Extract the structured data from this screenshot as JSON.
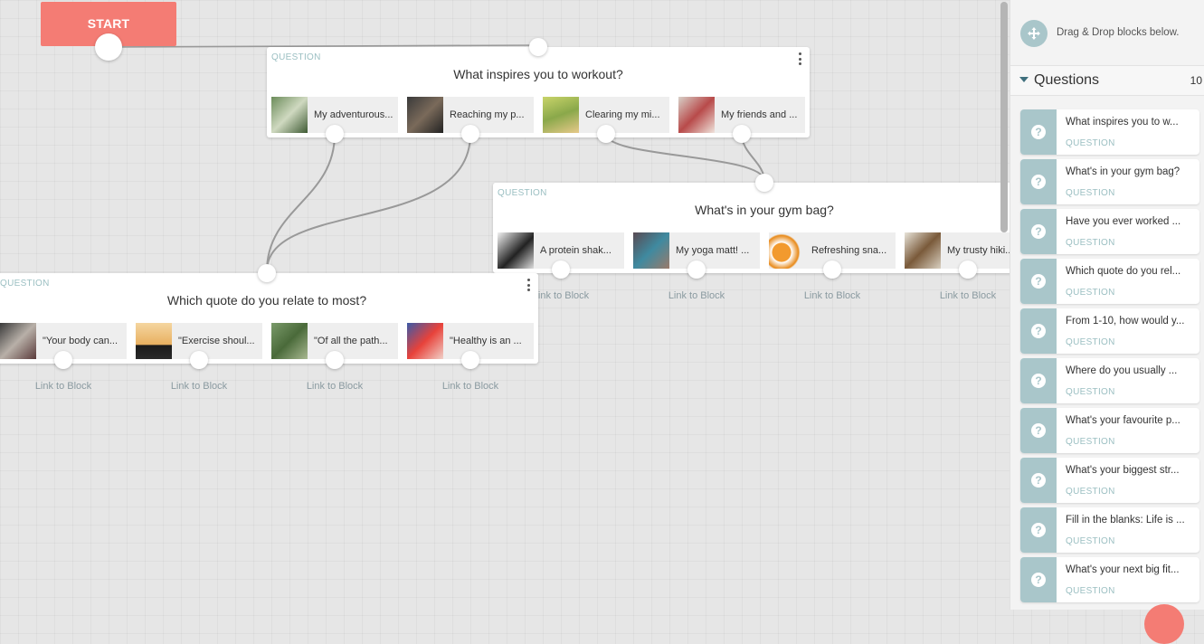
{
  "start": {
    "label": "START"
  },
  "link_label": "Link to Block",
  "blocks": [
    {
      "type_label": "QUESTION",
      "title": "What inspires you to workout?",
      "answers": [
        "My adventurous...",
        "Reaching my p...",
        "Clearing my mi...",
        "My friends and ..."
      ]
    },
    {
      "type_label": "QUESTION",
      "title": "What's in your gym bag?",
      "answers": [
        "A protein shak...",
        "My yoga matt! ...",
        "Refreshing sna...",
        "My trusty hiki..."
      ]
    },
    {
      "type_label": "QUESTION",
      "title": "Which quote do you relate to most?",
      "answers": [
        "\"Your body can...",
        "\"Exercise shoul...",
        "\"Of all the path...",
        "\"Healthy is an ..."
      ]
    }
  ],
  "sidebar": {
    "hint": "Drag & Drop blocks below.",
    "section_title": "Questions",
    "count": "10",
    "items": [
      {
        "title": "What inspires you to w...",
        "sub": "QUESTION"
      },
      {
        "title": "What's in your gym bag?",
        "sub": "QUESTION"
      },
      {
        "title": "Have you ever worked ...",
        "sub": "QUESTION"
      },
      {
        "title": "Which quote do you rel...",
        "sub": "QUESTION"
      },
      {
        "title": "From 1-10, how would y...",
        "sub": "QUESTION"
      },
      {
        "title": "Where do you usually ...",
        "sub": "QUESTION"
      },
      {
        "title": "What's your favourite p...",
        "sub": "QUESTION"
      },
      {
        "title": "What's your biggest str...",
        "sub": "QUESTION"
      },
      {
        "title": "Fill in the blanks: Life is ...",
        "sub": "QUESTION"
      },
      {
        "title": "What's your next big fit...",
        "sub": "QUESTION"
      }
    ]
  },
  "colors": {
    "accent": "#f47c74",
    "teal": "#a9c6ca",
    "canvas": "#e6e6e6"
  }
}
